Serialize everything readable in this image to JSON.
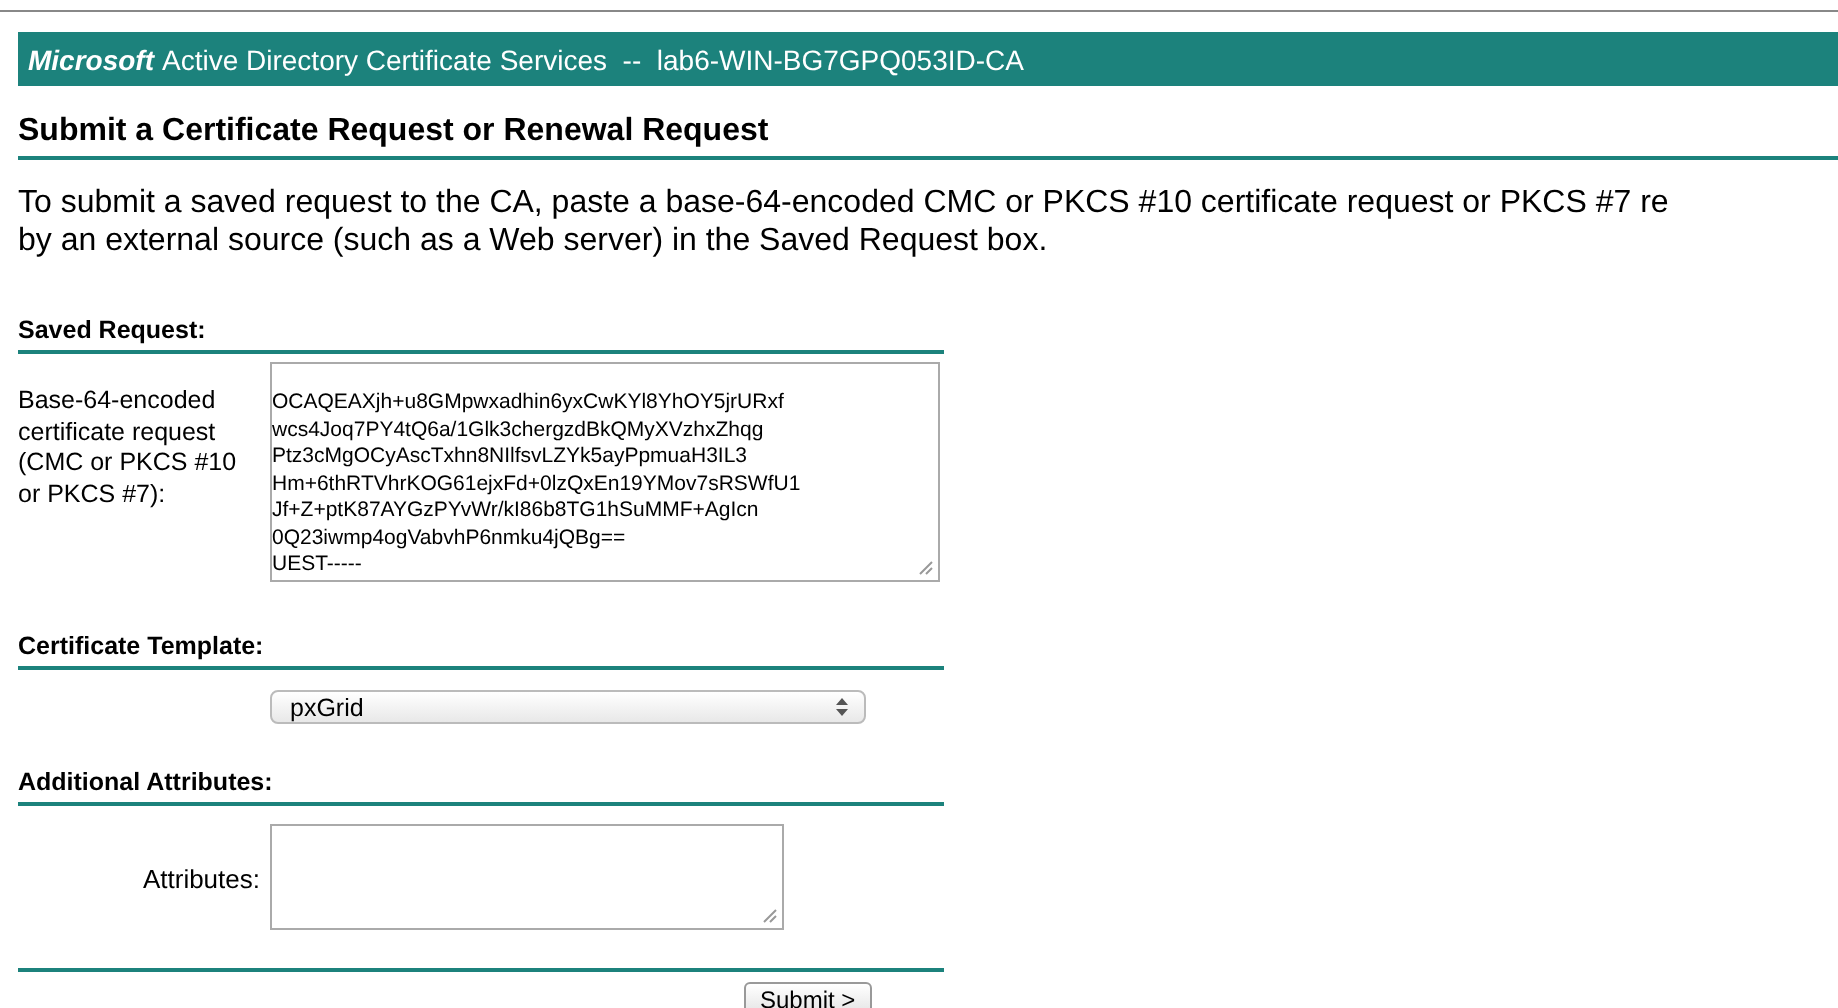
{
  "header": {
    "brand": "Microsoft",
    "title": "Active Directory Certificate Services  --  lab6-WIN-BG7GPQ053ID-CA"
  },
  "heading": "Submit a Certificate Request or Renewal Request",
  "intro_lines": [
    "To submit a saved request to the CA, paste a base-64-encoded CMC or PKCS #10 certificate request or PKCS #7 re",
    "by an external source (such as a Web server) in the Saved Request box."
  ],
  "saved_request": {
    "section": "Saved Request:",
    "label": "Base-64-encoded certificate request (CMC or PKCS #10 or PKCS #7):",
    "lines": [
      "OCAQEAXjh+u8GMpwxadhin6yxCwKYl8YhOY5jrURxf",
      "wcs4Joq7PY4tQ6a/1Glk3chergzdBkQMyXVzhxZhqg",
      "Ptz3cMgOCyAscTxhn8NIlfsvLZYk5ayPpmuaH3IL3",
      "Hm+6thRTVhrKOG61ejxFd+0lzQxEn19YMov7sRSWfU1",
      "Jf+Z+ptK87AYGzPYvWr/kI86b8TG1hSuMMF+AgIcn",
      "0Q23iwmp4ogVabvhP6nmku4jQBg==",
      "UEST-----"
    ]
  },
  "certificate_template": {
    "section": "Certificate Template:",
    "value": "pxGrid"
  },
  "additional_attributes": {
    "section": "Additional Attributes:",
    "label": "Attributes:"
  },
  "submit": "Submit >"
}
